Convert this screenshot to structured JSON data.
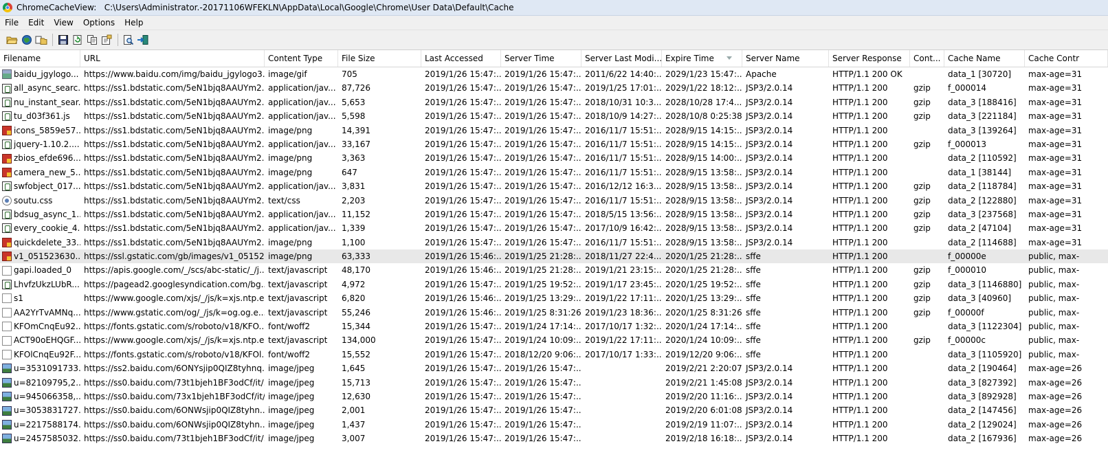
{
  "window": {
    "app_name": "ChromeCacheView:",
    "path": "C:\\Users\\Administrator.-20171106WFEKLN\\AppData\\Local\\Google\\Chrome\\User Data\\Default\\Cache"
  },
  "menu": [
    "File",
    "Edit",
    "View",
    "Options",
    "Help"
  ],
  "toolbar": {
    "buttons": [
      "open-folder-icon",
      "browser-globe-icon",
      "copy-files-icon",
      "save-icon",
      "refresh-icon",
      "copy-icon",
      "properties-icon",
      "find-icon",
      "exit-icon"
    ]
  },
  "columns": [
    {
      "key": "filename",
      "label": "Filename",
      "w": 117
    },
    {
      "key": "url",
      "label": "URL",
      "w": 268
    },
    {
      "key": "ctype",
      "label": "Content Type",
      "w": 107
    },
    {
      "key": "size",
      "label": "File Size",
      "w": 121
    },
    {
      "key": "accessed",
      "label": "Last Accessed",
      "w": 116
    },
    {
      "key": "server_time",
      "label": "Server Time",
      "w": 117
    },
    {
      "key": "server_mod",
      "label": "Server Last Modi...",
      "w": 117
    },
    {
      "key": "expire",
      "label": "Expire Time",
      "w": 117
    },
    {
      "key": "server_name",
      "label": "Server Name",
      "w": 126
    },
    {
      "key": "response",
      "label": "Server Response",
      "w": 118
    },
    {
      "key": "enc",
      "label": "Cont...",
      "w": 50
    },
    {
      "key": "cache_name",
      "label": "Cache Name",
      "w": 117
    },
    {
      "key": "cache_ctrl",
      "label": "Cache Contr",
      "w": 121
    }
  ],
  "rows": [
    {
      "icon": "gif",
      "filename": "baidu_jgylogo...",
      "url": "https://www.baidu.com/img/baidu_jgylogo3...",
      "ctype": "image/gif",
      "size": "705",
      "accessed": "2019/1/26 15:47:...",
      "server_time": "2019/1/26 15:47:...",
      "server_mod": "2011/6/22 14:40:...",
      "expire": "2029/1/23 15:47:...",
      "server_name": "Apache",
      "response": "HTTP/1.1 200 OK",
      "enc": "",
      "cache_name": "data_1  [30720]",
      "cache_ctrl": "max-age=31"
    },
    {
      "icon": "js",
      "filename": "all_async_searc...",
      "url": "https://ss1.bdstatic.com/5eN1bjq8AAUYm2...",
      "ctype": "application/jav...",
      "size": "87,726",
      "accessed": "2019/1/26 15:47:...",
      "server_time": "2019/1/26 15:47:...",
      "server_mod": "2019/1/25 17:01:...",
      "expire": "2029/1/22 18:12:...",
      "server_name": "JSP3/2.0.14",
      "response": "HTTP/1.1 200",
      "enc": "gzip",
      "cache_name": "f_000014",
      "cache_ctrl": "max-age=31"
    },
    {
      "icon": "js",
      "filename": "nu_instant_sear...",
      "url": "https://ss1.bdstatic.com/5eN1bjq8AAUYm2...",
      "ctype": "application/jav...",
      "size": "5,653",
      "accessed": "2019/1/26 15:47:...",
      "server_time": "2019/1/26 15:47:...",
      "server_mod": "2018/10/31 10:3...",
      "expire": "2028/10/28 17:4...",
      "server_name": "JSP3/2.0.14",
      "response": "HTTP/1.1 200",
      "enc": "gzip",
      "cache_name": "data_3  [188416]",
      "cache_ctrl": "max-age=31"
    },
    {
      "icon": "js",
      "filename": "tu_d03f361.js",
      "url": "https://ss1.bdstatic.com/5eN1bjq8AAUYm2...",
      "ctype": "application/jav...",
      "size": "5,598",
      "accessed": "2019/1/26 15:47:...",
      "server_time": "2019/1/26 15:47:...",
      "server_mod": "2018/10/9 14:27:...",
      "expire": "2028/10/8 0:25:38",
      "server_name": "JSP3/2.0.14",
      "response": "HTTP/1.1 200",
      "enc": "gzip",
      "cache_name": "data_3  [221184]",
      "cache_ctrl": "max-age=31"
    },
    {
      "icon": "png",
      "filename": "icons_5859e57...",
      "url": "https://ss1.bdstatic.com/5eN1bjq8AAUYm2...",
      "ctype": "image/png",
      "size": "14,391",
      "accessed": "2019/1/26 15:47:...",
      "server_time": "2019/1/26 15:47:...",
      "server_mod": "2016/11/7 15:51:...",
      "expire": "2028/9/15 14:15:...",
      "server_name": "JSP3/2.0.14",
      "response": "HTTP/1.1 200",
      "enc": "",
      "cache_name": "data_3  [139264]",
      "cache_ctrl": "max-age=31"
    },
    {
      "icon": "js",
      "filename": "jquery-1.10.2....",
      "url": "https://ss1.bdstatic.com/5eN1bjq8AAUYm2...",
      "ctype": "application/jav...",
      "size": "33,167",
      "accessed": "2019/1/26 15:47:...",
      "server_time": "2019/1/26 15:47:...",
      "server_mod": "2016/11/7 15:51:...",
      "expire": "2028/9/15 14:15:...",
      "server_name": "JSP3/2.0.14",
      "response": "HTTP/1.1 200",
      "enc": "gzip",
      "cache_name": "f_000013",
      "cache_ctrl": "max-age=31"
    },
    {
      "icon": "png",
      "filename": "zbios_efde696....",
      "url": "https://ss1.bdstatic.com/5eN1bjq8AAUYm2...",
      "ctype": "image/png",
      "size": "3,363",
      "accessed": "2019/1/26 15:47:...",
      "server_time": "2019/1/26 15:47:...",
      "server_mod": "2016/11/7 15:51:...",
      "expire": "2028/9/15 14:00:...",
      "server_name": "JSP3/2.0.14",
      "response": "HTTP/1.1 200",
      "enc": "",
      "cache_name": "data_2  [110592]",
      "cache_ctrl": "max-age=31"
    },
    {
      "icon": "png",
      "filename": "camera_new_5...",
      "url": "https://ss1.bdstatic.com/5eN1bjq8AAUYm2...",
      "ctype": "image/png",
      "size": "647",
      "accessed": "2019/1/26 15:47:...",
      "server_time": "2019/1/26 15:47:...",
      "server_mod": "2016/11/7 15:51:...",
      "expire": "2028/9/15 13:58:...",
      "server_name": "JSP3/2.0.14",
      "response": "HTTP/1.1 200",
      "enc": "",
      "cache_name": "data_1  [38144]",
      "cache_ctrl": "max-age=31"
    },
    {
      "icon": "js",
      "filename": "swfobject_017...",
      "url": "https://ss1.bdstatic.com/5eN1bjq8AAUYm2...",
      "ctype": "application/jav...",
      "size": "3,831",
      "accessed": "2019/1/26 15:47:...",
      "server_time": "2019/1/26 15:47:...",
      "server_mod": "2016/12/12 16:3...",
      "expire": "2028/9/15 13:58:...",
      "server_name": "JSP3/2.0.14",
      "response": "HTTP/1.1 200",
      "enc": "gzip",
      "cache_name": "data_2  [118784]",
      "cache_ctrl": "max-age=31"
    },
    {
      "icon": "css",
      "filename": "soutu.css",
      "url": "https://ss1.bdstatic.com/5eN1bjq8AAUYm2...",
      "ctype": "text/css",
      "size": "2,203",
      "accessed": "2019/1/26 15:47:...",
      "server_time": "2019/1/26 15:47:...",
      "server_mod": "2016/11/7 15:51:...",
      "expire": "2028/9/15 13:58:...",
      "server_name": "JSP3/2.0.14",
      "response": "HTTP/1.1 200",
      "enc": "gzip",
      "cache_name": "data_2  [122880]",
      "cache_ctrl": "max-age=31"
    },
    {
      "icon": "js",
      "filename": "bdsug_async_1...",
      "url": "https://ss1.bdstatic.com/5eN1bjq8AAUYm2...",
      "ctype": "application/jav...",
      "size": "11,152",
      "accessed": "2019/1/26 15:47:...",
      "server_time": "2019/1/26 15:47:...",
      "server_mod": "2018/5/15 13:56:...",
      "expire": "2028/9/15 13:58:...",
      "server_name": "JSP3/2.0.14",
      "response": "HTTP/1.1 200",
      "enc": "gzip",
      "cache_name": "data_3  [237568]",
      "cache_ctrl": "max-age=31"
    },
    {
      "icon": "js",
      "filename": "every_cookie_4...",
      "url": "https://ss1.bdstatic.com/5eN1bjq8AAUYm2...",
      "ctype": "application/jav...",
      "size": "1,339",
      "accessed": "2019/1/26 15:47:...",
      "server_time": "2019/1/26 15:47:...",
      "server_mod": "2017/10/9 16:42:...",
      "expire": "2028/9/15 13:58:...",
      "server_name": "JSP3/2.0.14",
      "response": "HTTP/1.1 200",
      "enc": "gzip",
      "cache_name": "data_2  [47104]",
      "cache_ctrl": "max-age=31"
    },
    {
      "icon": "png",
      "filename": "quickdelete_33...",
      "url": "https://ss1.bdstatic.com/5eN1bjq8AAUYm2...",
      "ctype": "image/png",
      "size": "1,100",
      "accessed": "2019/1/26 15:47:...",
      "server_time": "2019/1/26 15:47:...",
      "server_mod": "2016/11/7 15:51:...",
      "expire": "2028/9/15 13:58:...",
      "server_name": "JSP3/2.0.14",
      "response": "HTTP/1.1 200",
      "enc": "",
      "cache_name": "data_2  [114688]",
      "cache_ctrl": "max-age=31"
    },
    {
      "icon": "png",
      "selected": true,
      "filename": "v1_051523630...",
      "url": "https://ssl.gstatic.com/gb/images/v1_05152...",
      "ctype": "image/png",
      "size": "63,333",
      "accessed": "2019/1/26 15:46:...",
      "server_time": "2019/1/25 21:28:...",
      "server_mod": "2018/11/27 22:4...",
      "expire": "2020/1/25 21:28:...",
      "server_name": "sffe",
      "response": "HTTP/1.1 200",
      "enc": "",
      "cache_name": "f_00000e",
      "cache_ctrl": "public, max-"
    },
    {
      "icon": "blank",
      "filename": "gapi.loaded_0",
      "url": "https://apis.google.com/_/scs/abc-static/_/j...",
      "ctype": "text/javascript",
      "size": "48,170",
      "accessed": "2019/1/26 15:46:...",
      "server_time": "2019/1/25 21:28:...",
      "server_mod": "2019/1/21 23:15:...",
      "expire": "2020/1/25 21:28:...",
      "server_name": "sffe",
      "response": "HTTP/1.1 200",
      "enc": "gzip",
      "cache_name": "f_000010",
      "cache_ctrl": "public, max-"
    },
    {
      "icon": "js",
      "filename": "LhvfzUkzLUbR...",
      "url": "https://pagead2.googlesyndication.com/bg...",
      "ctype": "text/javascript",
      "size": "4,972",
      "accessed": "2019/1/26 15:47:...",
      "server_time": "2019/1/25 19:52:...",
      "server_mod": "2019/1/17 23:45:...",
      "expire": "2020/1/25 19:52:...",
      "server_name": "sffe",
      "response": "HTTP/1.1 200",
      "enc": "gzip",
      "cache_name": "data_3  [1146880]",
      "cache_ctrl": "public, max-"
    },
    {
      "icon": "blank",
      "filename": "s1",
      "url": "https://www.google.com/xjs/_/js/k=xjs.ntp.e...",
      "ctype": "text/javascript",
      "size": "6,820",
      "accessed": "2019/1/26 15:46:...",
      "server_time": "2019/1/25 13:29:...",
      "server_mod": "2019/1/22 17:11:...",
      "expire": "2020/1/25 13:29:...",
      "server_name": "sffe",
      "response": "HTTP/1.1 200",
      "enc": "gzip",
      "cache_name": "data_3  [40960]",
      "cache_ctrl": "public, max-"
    },
    {
      "icon": "blank",
      "filename": "AA2YrTvAMNq...",
      "url": "https://www.gstatic.com/og/_/js/k=og.og.e...",
      "ctype": "text/javascript",
      "size": "55,246",
      "accessed": "2019/1/26 15:46:...",
      "server_time": "2019/1/25 8:31:26",
      "server_mod": "2019/1/23 18:36:...",
      "expire": "2020/1/25 8:31:26",
      "server_name": "sffe",
      "response": "HTTP/1.1 200",
      "enc": "gzip",
      "cache_name": "f_00000f",
      "cache_ctrl": "public, max-"
    },
    {
      "icon": "blank",
      "filename": "KFOmCnqEu92...",
      "url": "https://fonts.gstatic.com/s/roboto/v18/KFO...",
      "ctype": "font/woff2",
      "size": "15,344",
      "accessed": "2019/1/26 15:47:...",
      "server_time": "2019/1/24 17:14:...",
      "server_mod": "2017/10/17 1:32:...",
      "expire": "2020/1/24 17:14:...",
      "server_name": "sffe",
      "response": "HTTP/1.1 200",
      "enc": "",
      "cache_name": "data_3  [1122304]",
      "cache_ctrl": "public, max-"
    },
    {
      "icon": "blank",
      "filename": "ACT90oEHQGF...",
      "url": "https://www.google.com/xjs/_/js/k=xjs.ntp.e...",
      "ctype": "text/javascript",
      "size": "134,000",
      "accessed": "2019/1/26 15:47:...",
      "server_time": "2019/1/24 10:09:...",
      "server_mod": "2019/1/22 17:11:...",
      "expire": "2020/1/24 10:09:...",
      "server_name": "sffe",
      "response": "HTTP/1.1 200",
      "enc": "gzip",
      "cache_name": "f_00000c",
      "cache_ctrl": "public, max-"
    },
    {
      "icon": "blank",
      "filename": "KFOlCnqEu92F...",
      "url": "https://fonts.gstatic.com/s/roboto/v18/KFOl...",
      "ctype": "font/woff2",
      "size": "15,552",
      "accessed": "2019/1/26 15:47:...",
      "server_time": "2018/12/20 9:06:...",
      "server_mod": "2017/10/17 1:33:...",
      "expire": "2019/12/20 9:06:...",
      "server_name": "sffe",
      "response": "HTTP/1.1 200",
      "enc": "",
      "cache_name": "data_3  [1105920]",
      "cache_ctrl": "public, max-"
    },
    {
      "icon": "jpeg",
      "filename": "u=3531091733...",
      "url": "https://ss2.baidu.com/6ONYsjip0QIZ8tyhnq...",
      "ctype": "image/jpeg",
      "size": "1,645",
      "accessed": "2019/1/26 15:47:...",
      "server_time": "2019/1/26 15:47:...",
      "server_mod": "",
      "expire": "2019/2/21 2:20:07",
      "server_name": "JSP3/2.0.14",
      "response": "HTTP/1.1 200",
      "enc": "",
      "cache_name": "data_2  [190464]",
      "cache_ctrl": "max-age=26"
    },
    {
      "icon": "jpeg",
      "filename": "u=82109795,2...",
      "url": "https://ss0.baidu.com/73t1bjeh1BF3odCf/it/...",
      "ctype": "image/jpeg",
      "size": "15,713",
      "accessed": "2019/1/26 15:47:...",
      "server_time": "2019/1/26 15:47:...",
      "server_mod": "",
      "expire": "2019/2/21 1:45:08",
      "server_name": "JSP3/2.0.14",
      "response": "HTTP/1.1 200",
      "enc": "",
      "cache_name": "data_3  [827392]",
      "cache_ctrl": "max-age=26"
    },
    {
      "icon": "jpeg",
      "filename": "u=945066358,...",
      "url": "https://ss0.baidu.com/73x1bjeh1BF3odCf/it/...",
      "ctype": "image/jpeg",
      "size": "12,630",
      "accessed": "2019/1/26 15:47:...",
      "server_time": "2019/1/26 15:47:...",
      "server_mod": "",
      "expire": "2019/2/20 11:16:...",
      "server_name": "JSP3/2.0.14",
      "response": "HTTP/1.1 200",
      "enc": "",
      "cache_name": "data_3  [892928]",
      "cache_ctrl": "max-age=26"
    },
    {
      "icon": "jpeg",
      "filename": "u=3053831727...",
      "url": "https://ss0.baidu.com/6ONWsjip0QIZ8tyhn...",
      "ctype": "image/jpeg",
      "size": "2,001",
      "accessed": "2019/1/26 15:47:...",
      "server_time": "2019/1/26 15:47:...",
      "server_mod": "",
      "expire": "2019/2/20 6:01:08",
      "server_name": "JSP3/2.0.14",
      "response": "HTTP/1.1 200",
      "enc": "",
      "cache_name": "data_2  [147456]",
      "cache_ctrl": "max-age=26"
    },
    {
      "icon": "jpeg",
      "filename": "u=2217588174...",
      "url": "https://ss0.baidu.com/6ONWsjip0QIZ8tyhn...",
      "ctype": "image/jpeg",
      "size": "1,437",
      "accessed": "2019/1/26 15:47:...",
      "server_time": "2019/1/26 15:47:...",
      "server_mod": "",
      "expire": "2019/2/19 11:07:...",
      "server_name": "JSP3/2.0.14",
      "response": "HTTP/1.1 200",
      "enc": "",
      "cache_name": "data_2  [129024]",
      "cache_ctrl": "max-age=26"
    },
    {
      "icon": "jpeg",
      "filename": "u=2457585032...",
      "url": "https://ss0.baidu.com/73t1bjeh1BF3odCf/it/...",
      "ctype": "image/jpeg",
      "size": "3,007",
      "accessed": "2019/1/26 15:47:...",
      "server_time": "2019/1/26 15:47:...",
      "server_mod": "",
      "expire": "2019/2/18 16:18:...",
      "server_name": "JSP3/2.0.14",
      "response": "HTTP/1.1 200",
      "enc": "",
      "cache_name": "data_2  [167936]",
      "cache_ctrl": "max-age=26"
    }
  ]
}
